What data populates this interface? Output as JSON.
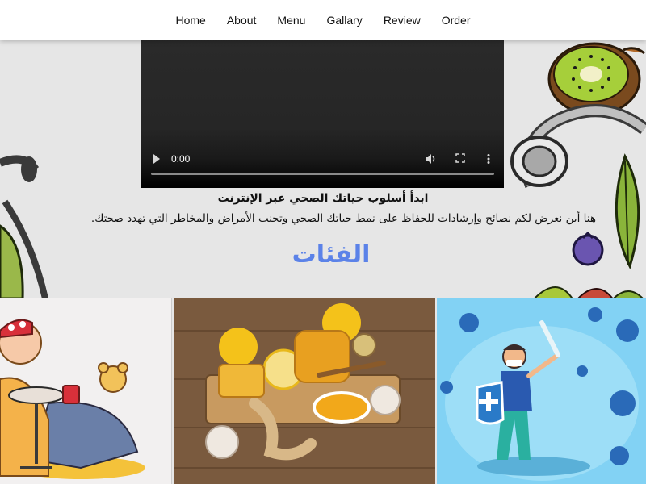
{
  "nav": {
    "items": [
      "Home",
      "About",
      "Menu",
      "Gallary",
      "Review",
      "Order"
    ]
  },
  "video": {
    "time": "0:00"
  },
  "hero": {
    "title": "ابدأ أسلوب حياتك الصحي عبر الإنترنت",
    "description": "هنا أين نعرض لكم نصائح وإرشادات للحفاظ على نمط حياتك الصحي وتجنب الأمراض والمخاطر التي تهدد صحتك.",
    "categories_heading": "الفئات"
  },
  "colors": {
    "heading": "#5b82e8",
    "nav_bg": "#ffffff",
    "page_bg": "#e6e6e6"
  }
}
